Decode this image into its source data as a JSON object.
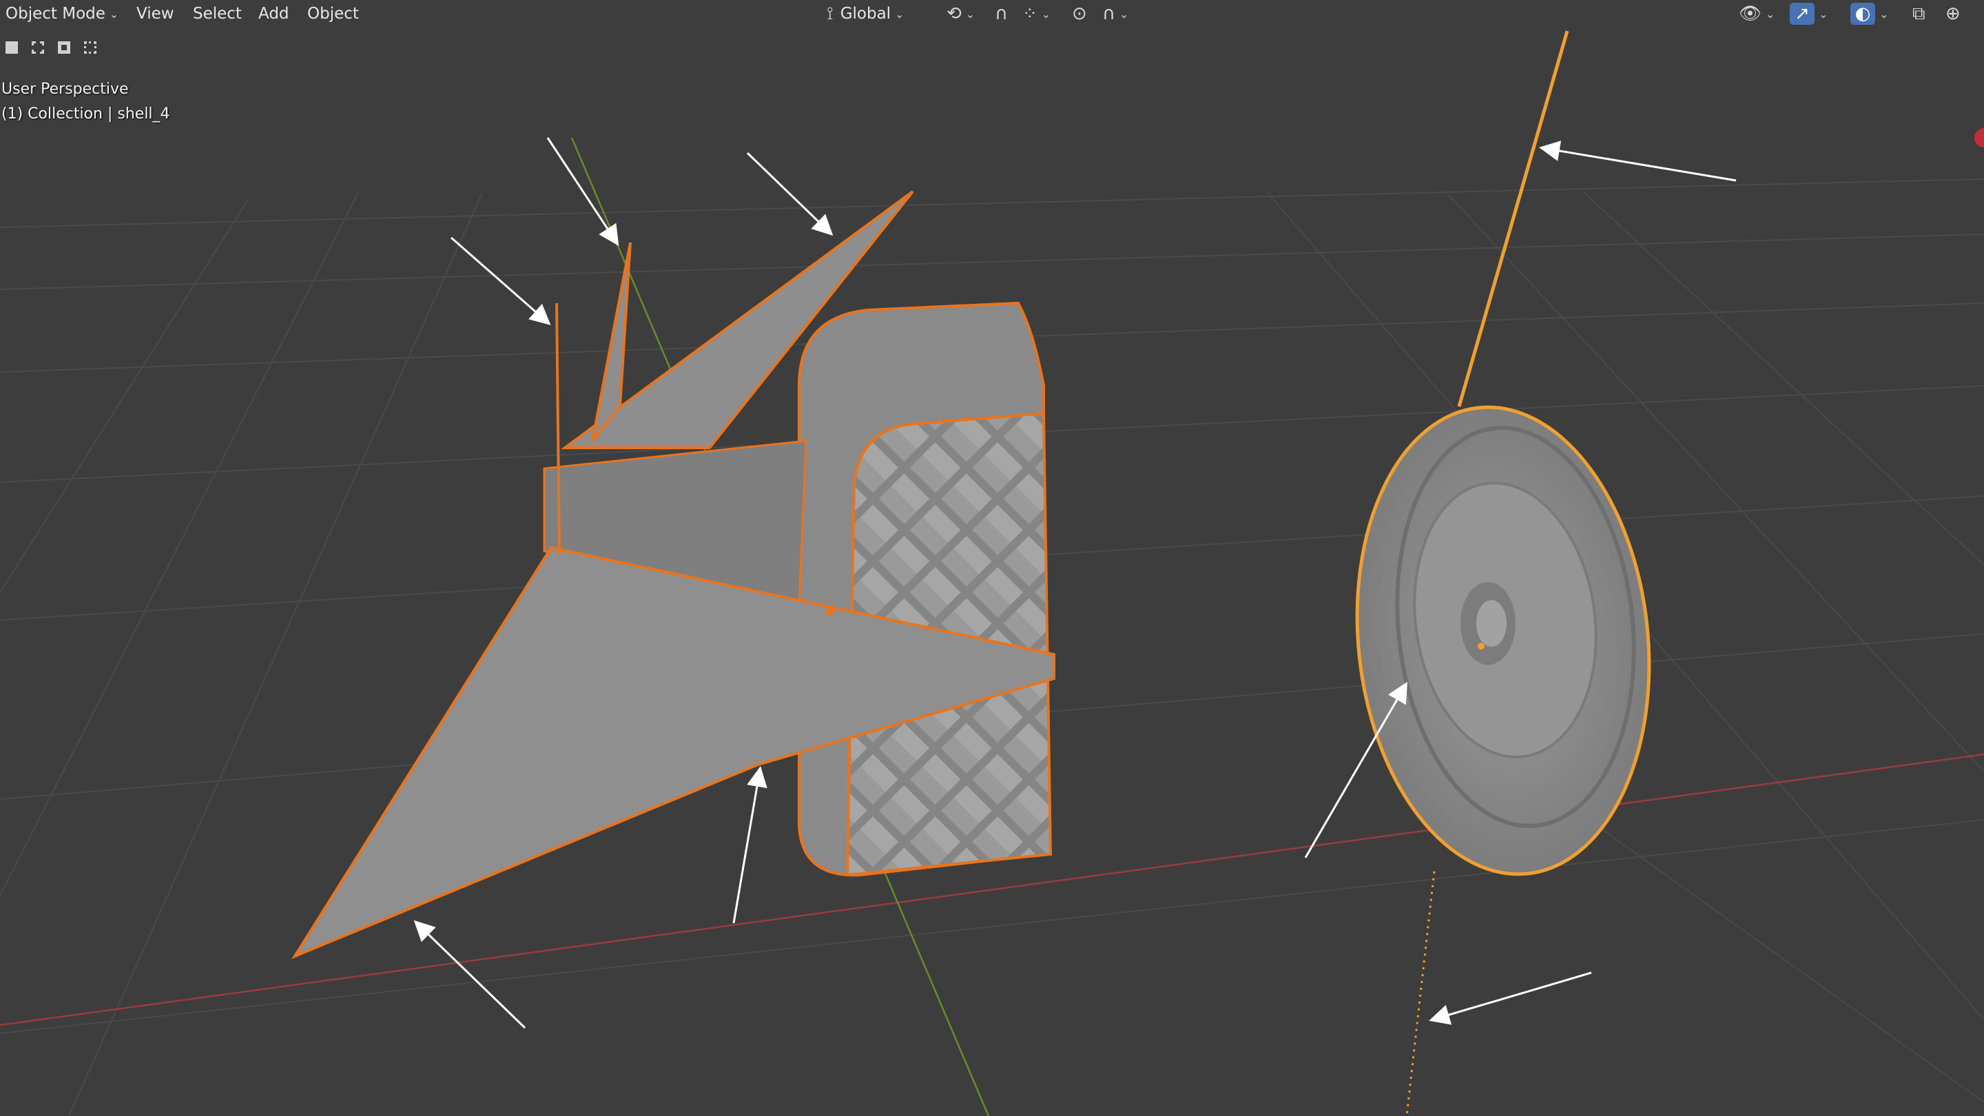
{
  "header": {
    "mode": "Object Mode",
    "menus": [
      "View",
      "Select",
      "Add",
      "Object"
    ],
    "orientation": "Global"
  },
  "viewport_info": {
    "perspective": "User Perspective",
    "collection": "(1) Collection | shell_4"
  },
  "icons": {
    "orientation": "transform-orientation-icon",
    "pivot": "pivot-point-icon",
    "snap": "snap-magnet-icon",
    "snap_target": "snap-increment-icon",
    "proportional": "proportional-editing-icon",
    "falloff": "falloff-curve-icon",
    "visibility": "eye-visibility-icon",
    "gizmo": "gizmo-icon",
    "overlay": "overlay-icon",
    "xray": "xray-icon",
    "shading": "wireframe-shading-icon"
  },
  "colors": {
    "background": "#3d3d3d",
    "grid": "#4a4a4a",
    "x_axis": "#9c3a3f",
    "y_axis": "#6a8a2a",
    "selection_outline": "#e8741e",
    "active_outline": "#f0a030",
    "mesh": "#8f8f8f",
    "arrow": "#ffffff"
  }
}
